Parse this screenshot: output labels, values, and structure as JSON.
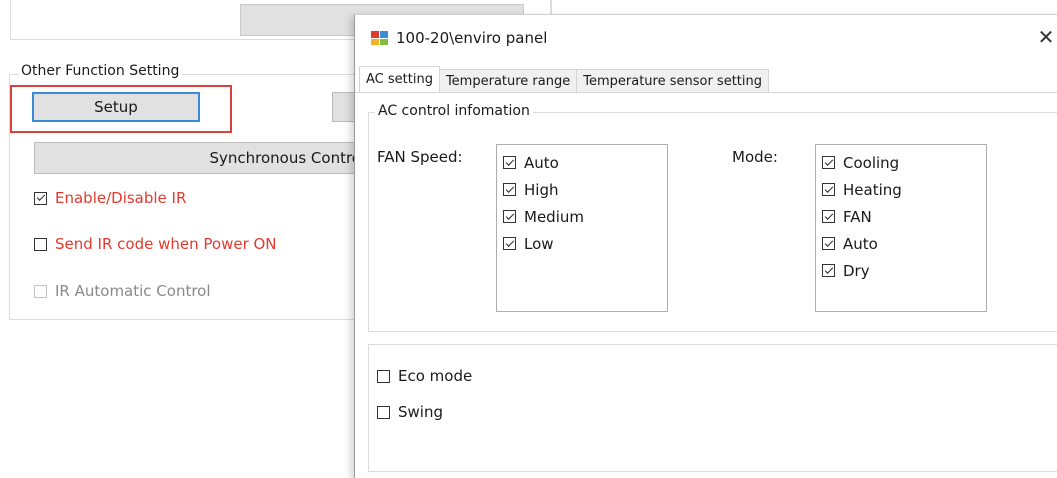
{
  "background": {
    "group_title": "Other Function Setting",
    "setup_label": "Setup",
    "sync_label": "Synchronous Contro",
    "checkboxes": [
      {
        "label": "Enable/Disable IR",
        "checked": true,
        "color": "#e33a2e"
      },
      {
        "label": "Send IR code when Power ON",
        "checked": false,
        "color": "#e33a2e"
      },
      {
        "label": "IR Automatic Control",
        "checked": false,
        "disabled": true,
        "color": "#8a8a8a"
      }
    ],
    "highlight_color": "#d9423a"
  },
  "dialog": {
    "title": "100-20\\enviro panel",
    "close_glyph": "✕",
    "tabs": [
      "AC setting",
      "Temperature range",
      "Temperature sensor setting"
    ],
    "active_tab": "AC setting",
    "ac_group_title": "AC control infomation",
    "fan_label": "FAN Speed:",
    "fan_options": [
      {
        "label": "Auto",
        "checked": true
      },
      {
        "label": "High",
        "checked": true
      },
      {
        "label": "Medium",
        "checked": true
      },
      {
        "label": "Low",
        "checked": true
      }
    ],
    "mode_label": "Mode:",
    "mode_options": [
      {
        "label": "Cooling",
        "checked": true
      },
      {
        "label": "Heating",
        "checked": true
      },
      {
        "label": "FAN",
        "checked": true
      },
      {
        "label": "Auto",
        "checked": true
      },
      {
        "label": "Dry",
        "checked": true
      }
    ],
    "eco_label": "Eco mode",
    "eco_checked": false,
    "swing_label": "Swing",
    "swing_checked": false
  }
}
